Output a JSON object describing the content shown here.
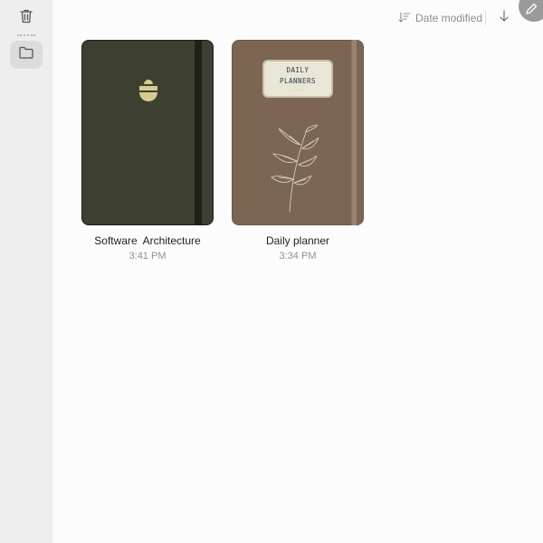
{
  "sidebar": {
    "icons": [
      "trash-icon",
      "folder-icon"
    ]
  },
  "toolbar": {
    "sort_label": "Date modified",
    "sort_icon": "sort-lines-icon",
    "direction_icon": "arrow-down-icon",
    "compose_icon": "pencil-icon"
  },
  "notebooks": [
    {
      "title": "Software  Architecture",
      "time": "3:41 PM",
      "cover_color": "#3d3f31",
      "emblem_color": "#d7cc8f"
    },
    {
      "title": "Daily planner",
      "time": "3:34 PM",
      "cover_color": "#7c6653",
      "label_line1": "DAILY",
      "label_line2": "PLANNERS"
    }
  ]
}
